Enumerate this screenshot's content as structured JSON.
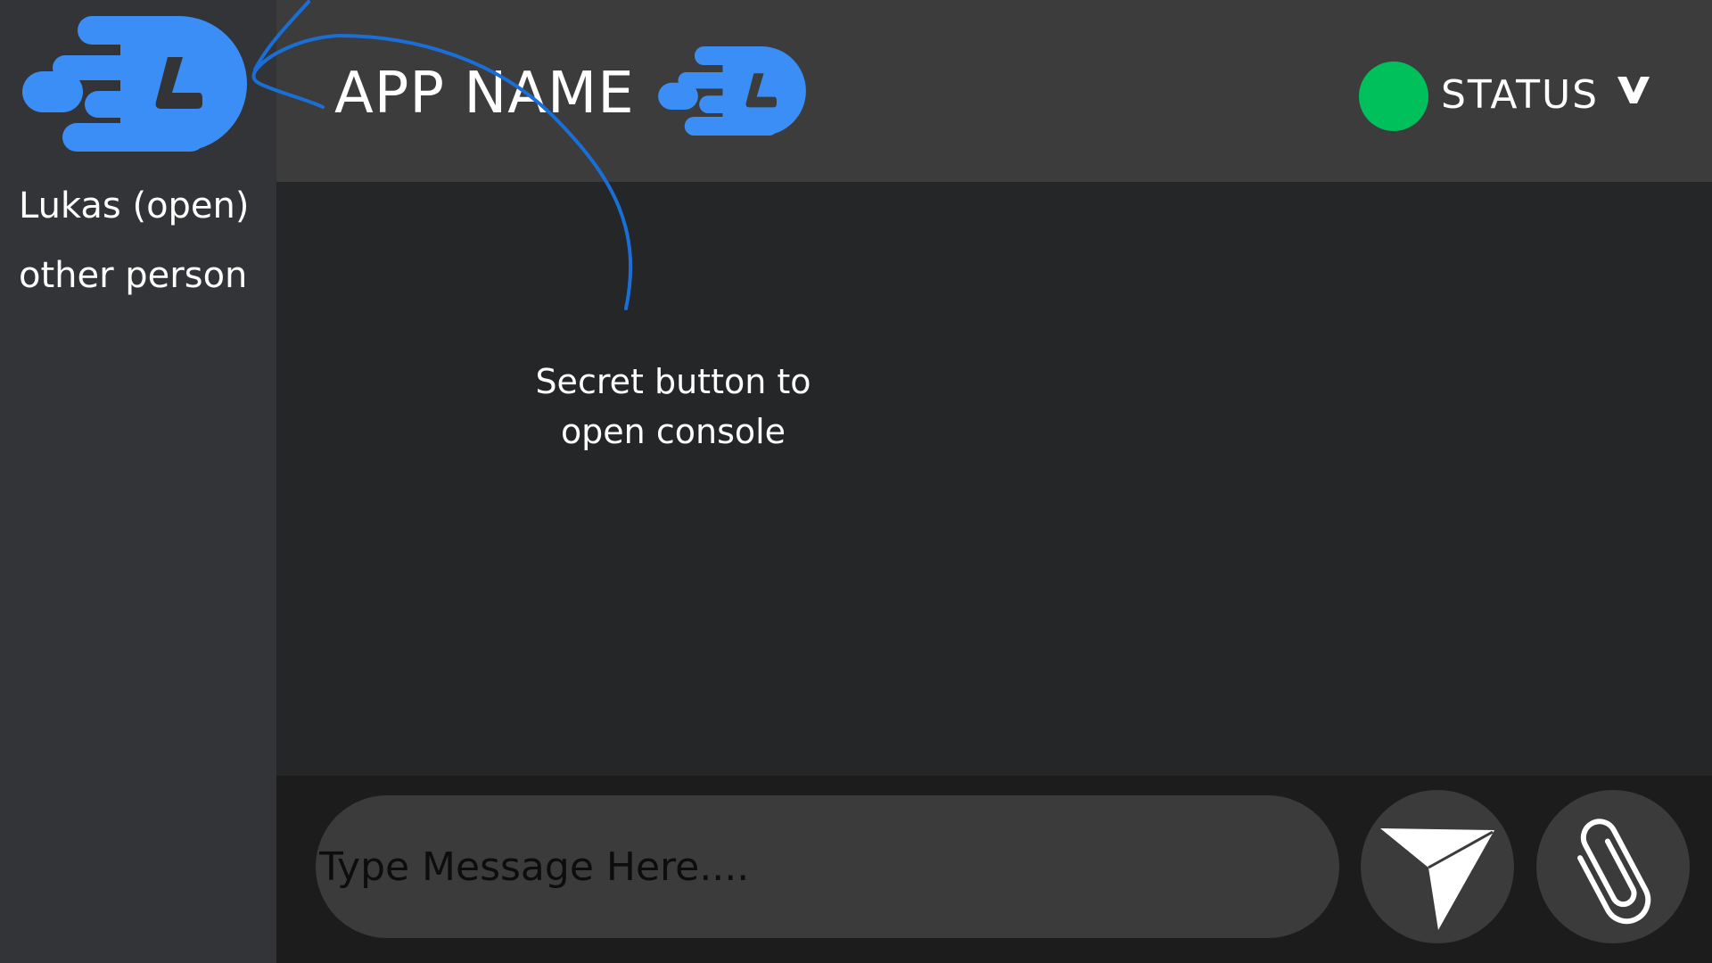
{
  "app": {
    "title": "APP NAME",
    "logo_icon": "speed-l-logo-icon",
    "brand_color": "#3a8ef6"
  },
  "sidebar": {
    "contacts": [
      {
        "label": "Lukas (open)"
      },
      {
        "label": "other person"
      }
    ]
  },
  "header": {
    "status_label": "STATUS",
    "status_color": "#00c05c",
    "status_toggle_icon": "chevron-down-icon"
  },
  "annotation": {
    "text": "Secret button to open console",
    "color": "#1a6fd6"
  },
  "composer": {
    "placeholder": "Type Message Here....",
    "send_icon": "send-icon",
    "attach_icon": "paperclip-icon"
  }
}
